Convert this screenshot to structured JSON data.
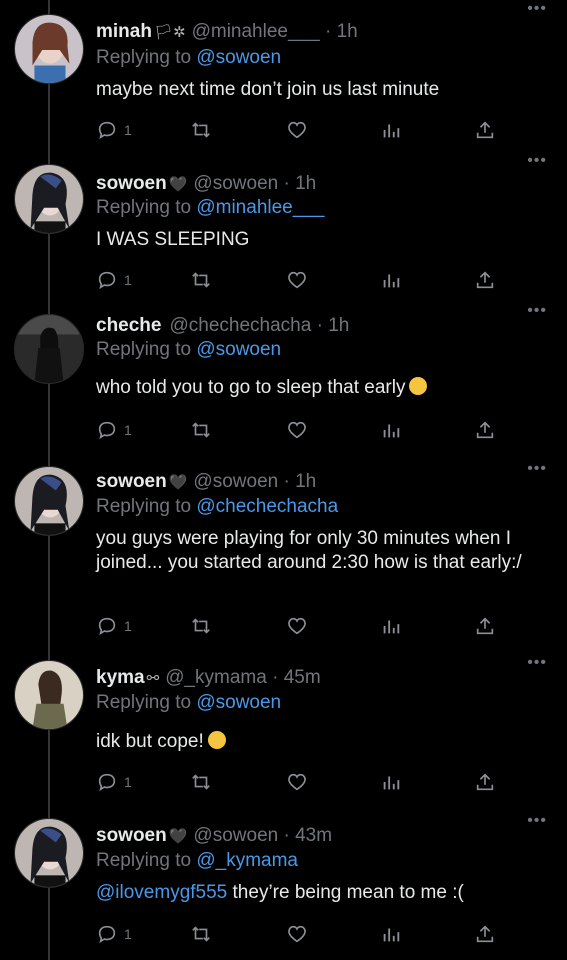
{
  "tweets": [
    {
      "name": "minah",
      "badge": "🏳✲",
      "handle": "@minahlee___",
      "time": "1h",
      "replying_label": "Replying to",
      "replying_to": "@sowoen",
      "mention": "",
      "text": "maybe next time don’t join us last minute",
      "emoji": "",
      "reply_count": "1",
      "avatar": "avatar-minah"
    },
    {
      "name": "sowoen",
      "badge": "🖤",
      "handle": "@sowoen",
      "time": "1h",
      "replying_label": "Replying to",
      "replying_to": "@minahlee___",
      "mention": "",
      "text": "I WAS SLEEPING",
      "emoji": "",
      "reply_count": "1",
      "avatar": "avatar-sowoen"
    },
    {
      "name": "cheche",
      "badge": "",
      "handle": "@chechechacha",
      "time": "1h",
      "replying_label": "Replying to",
      "replying_to": "@sowoen",
      "mention": "",
      "text": "who told you to go to sleep that early",
      "emoji": "face-with-rolling-eyes-emoji",
      "reply_count": "1",
      "avatar": "avatar-cheche"
    },
    {
      "name": "sowoen",
      "badge": "🖤",
      "handle": "@sowoen",
      "time": "1h",
      "replying_label": "Replying to",
      "replying_to": "@chechechacha",
      "mention": "",
      "text": "you guys were playing for only 30 minutes when I joined... you started around 2:30 how is that early:/",
      "emoji": "",
      "reply_count": "1",
      "avatar": "avatar-sowoen"
    },
    {
      "name": "kyma",
      "badge": "⚯",
      "handle": "@_kymama",
      "time": "45m",
      "replying_label": "Replying to",
      "replying_to": "@sowoen",
      "mention": "",
      "text": "idk but cope!",
      "emoji": "hugging-face-emoji",
      "reply_count": "1",
      "avatar": "avatar-kyma"
    },
    {
      "name": "sowoen",
      "badge": "🖤",
      "handle": "@sowoen",
      "time": "43m",
      "replying_label": "Replying to",
      "replying_to": "@_kymama",
      "mention": "@ilovemygf555",
      "text": " they’re being mean to me :(",
      "emoji": "",
      "reply_count": "1",
      "avatar": "avatar-sowoen"
    }
  ],
  "dot_separator": "·",
  "more_icon": "more-icon",
  "colors": {
    "background": "#000000",
    "text": "#e7e9ea",
    "muted": "#71767b",
    "link": "#4a99e9"
  }
}
